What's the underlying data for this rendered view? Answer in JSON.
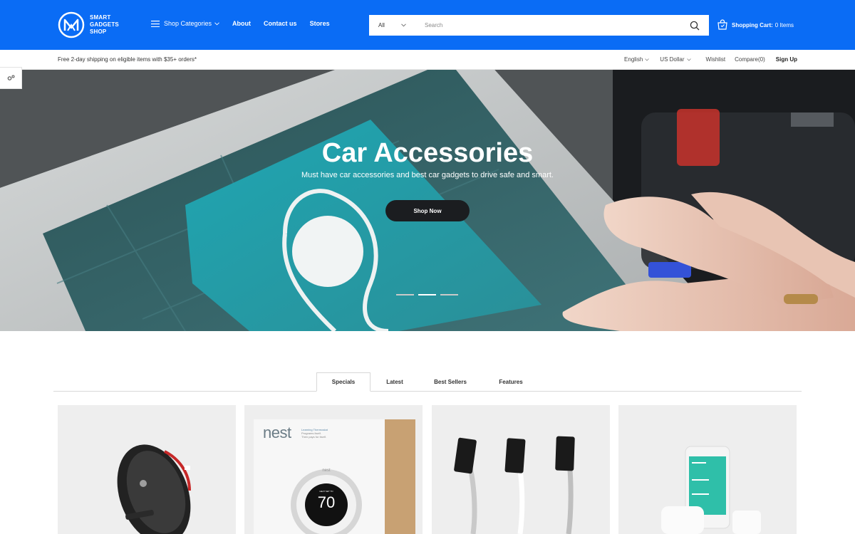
{
  "brand": {
    "line1": "SMART",
    "line2": "GADGETS",
    "line3": "SHOP"
  },
  "nav": {
    "categories_label": "Shop Categories",
    "about": "About",
    "contact": "Contact us",
    "stores": "Stores"
  },
  "search": {
    "category": "All",
    "placeholder": "Search"
  },
  "cart": {
    "label": "Shopping Cart:",
    "count": "0 Items"
  },
  "subbar": {
    "shipping": "Free 2-day shipping on eligible items with $35+ orders*",
    "language": "English",
    "currency": "US Dollar",
    "wishlist": "Wishlist",
    "compare": "Compare(0)",
    "signup": "Sign Up"
  },
  "hero": {
    "title": "Car Accessories",
    "subtitle": "Must have car accessories and best car gadgets to drive safe and smart.",
    "cta": "Shop Now",
    "slide_count": 3,
    "active_slide": 2
  },
  "tabs": [
    "Specials",
    "Latest",
    "Best Sellers",
    "Features"
  ],
  "active_tab": "Specials",
  "products": {
    "nest_logo": "nest",
    "nest_caption_1": "Learning Thermostat",
    "nest_caption_2": "Programs itself.",
    "nest_caption_3": "Then pays for itself.",
    "nest_small": "nest",
    "nest_heat": "HEAT SET TO",
    "nest_temp": "70"
  },
  "colors": {
    "brand_blue": "#0a6cf5",
    "button_dark": "#1b1d20"
  },
  "icons": [
    "menu-icon",
    "chevron-down-icon",
    "search-icon",
    "cart-icon",
    "settings-icon"
  ]
}
